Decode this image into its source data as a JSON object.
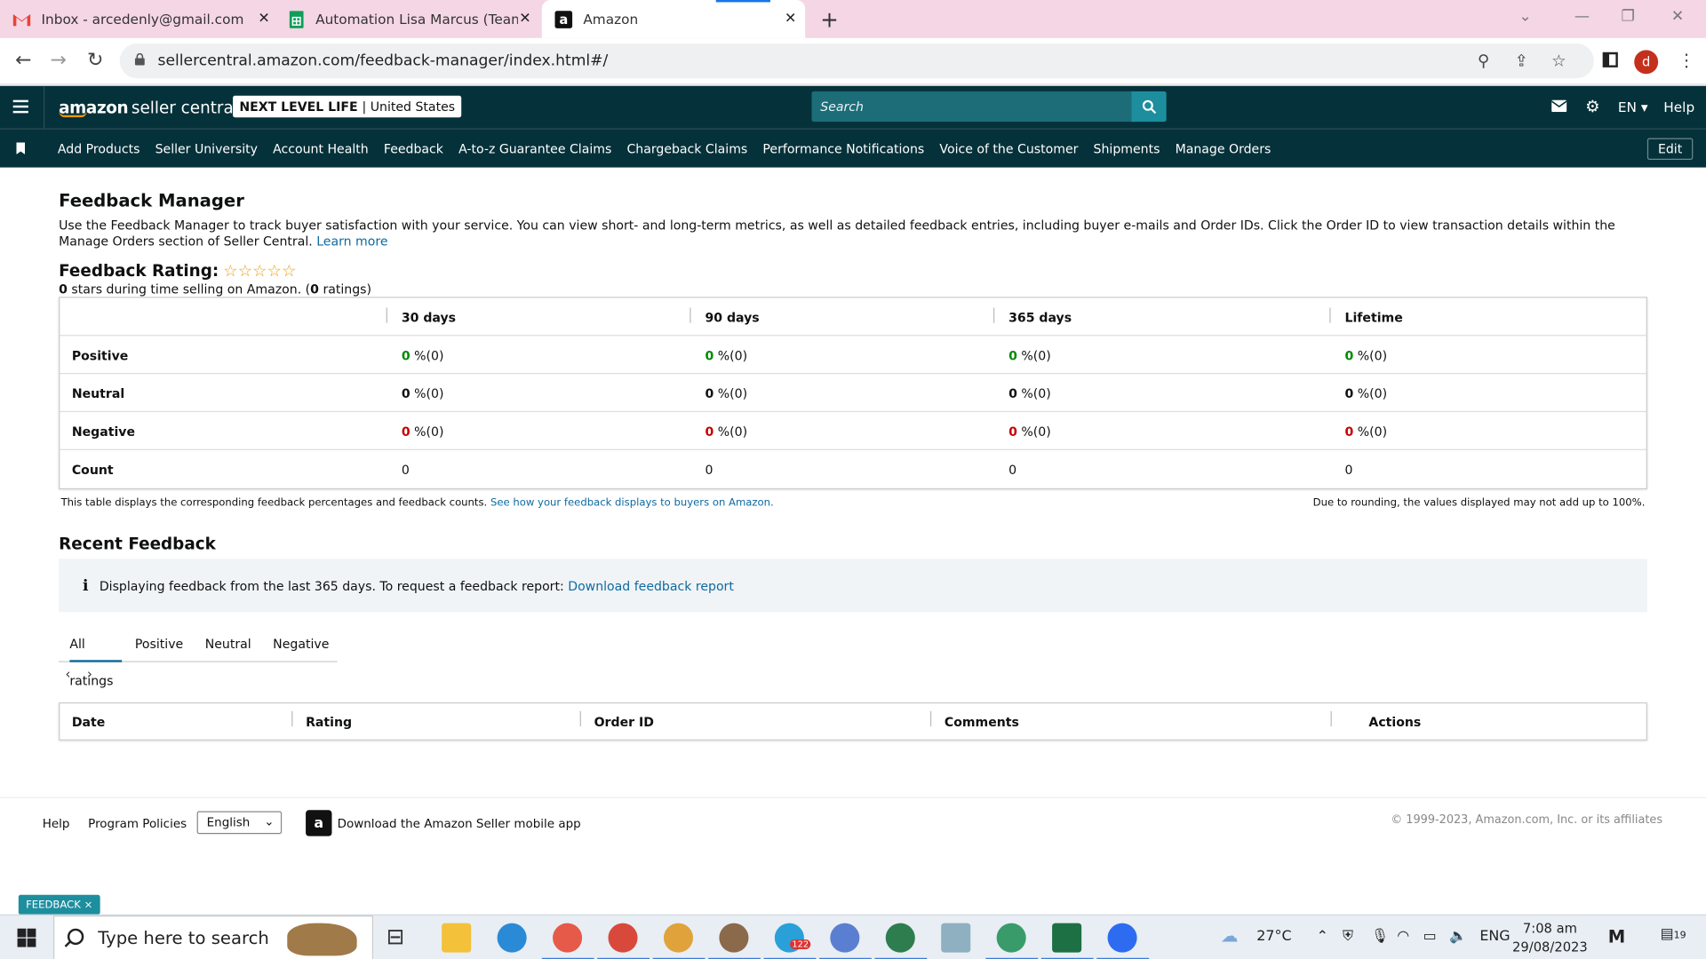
{
  "browser": {
    "tabs": [
      {
        "title": "Inbox - arcedenly@gmail.com - G",
        "icon": "gmail-icon"
      },
      {
        "title": "Automation Lisa Marcus (Team C",
        "icon": "sheets-icon"
      },
      {
        "title": "Amazon",
        "icon": "amazon-icon"
      }
    ],
    "url": "sellercentral.amazon.com/feedback-manager/index.html#/",
    "profile_initial": "d"
  },
  "header": {
    "logo_bold": "amazon",
    "logo_text": "seller central",
    "store_name": "NEXT LEVEL LIFE",
    "store_market": "| United States",
    "search_placeholder": "Search",
    "language": "EN",
    "help": "Help"
  },
  "nav": {
    "items": [
      "Add Products",
      "Seller University",
      "Account Health",
      "Feedback",
      "A-to-z Guarantee Claims",
      "Chargeback Claims",
      "Performance Notifications",
      "Voice of the Customer",
      "Shipments",
      "Manage Orders"
    ],
    "edit": "Edit"
  },
  "page": {
    "title": "Feedback Manager",
    "intro": "Use the Feedback Manager to track buyer satisfaction with your service. You can view short- and long-term metrics, as well as detailed feedback entries, including buyer e-mails and Order IDs. Click the Order ID to view transaction details within the Manage Orders section of Seller Central.",
    "learn_more": "Learn more",
    "rating_label": "Feedback Rating:",
    "stars": "☆☆☆☆☆",
    "stars_value": 0,
    "rating_sub_a": "0",
    "rating_sub_b": " stars during time selling on Amazon. (",
    "rating_sub_c": "0",
    "rating_sub_d": " ratings)",
    "table": {
      "columns": [
        "30 days",
        "90 days",
        "365 days",
        "Lifetime"
      ],
      "rows": [
        {
          "label": "Positive",
          "values": [
            "0",
            "0",
            "0",
            "0"
          ],
          "suffix": "%(0)"
        },
        {
          "label": "Neutral",
          "values": [
            "0",
            "0",
            "0",
            "0"
          ],
          "suffix": "%(0)"
        },
        {
          "label": "Negative",
          "values": [
            "0",
            "0",
            "0",
            "0"
          ],
          "suffix": "%(0)"
        },
        {
          "label": "Count",
          "values": [
            "0",
            "0",
            "0",
            "0"
          ]
        }
      ]
    },
    "table_note": "This table displays the corresponding feedback percentages and feedback counts.",
    "table_note_link": "See how your feedback displays to buyers on Amazon.",
    "rounding_note": "Due to rounding, the values displayed may not add up to 100%.",
    "recent_title": "Recent Feedback",
    "info_text": "Displaying feedback from the last 365 days. To request a feedback report:",
    "info_link": "Download feedback report",
    "filter_tabs": [
      "All ratings",
      "Positive",
      "Neutral",
      "Negative"
    ],
    "pager_prev": "‹",
    "pager_next": "›",
    "recent_columns": [
      "Date",
      "Rating",
      "Order ID",
      "Comments",
      "Actions"
    ]
  },
  "footer": {
    "help": "Help",
    "policies": "Program Policies",
    "language": "English",
    "app_text": "Download the Amazon Seller mobile app",
    "copyright": "© 1999-2023, Amazon.com, Inc. or its affiliates",
    "feedback_tag": "FEEDBACK ×"
  },
  "taskbar": {
    "search_placeholder": "Type here to search",
    "weather": "27°C",
    "lang": "ENG",
    "time": "7:08 am",
    "date": "29/08/2023",
    "notif": "19",
    "telegram_badge": "122"
  }
}
